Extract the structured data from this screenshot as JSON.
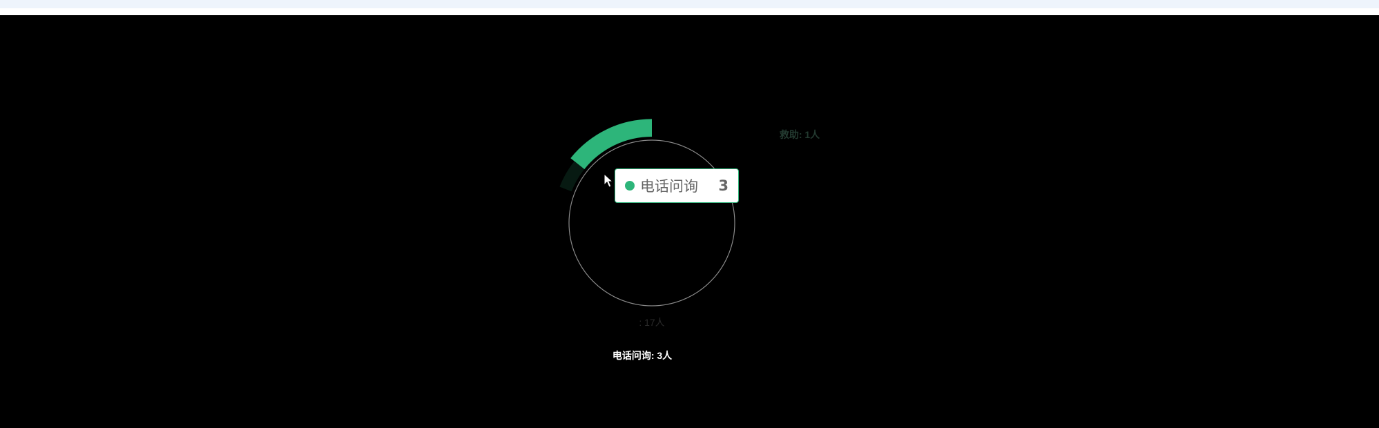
{
  "chart_data": {
    "type": "pie",
    "variant": "rose",
    "unit": "人",
    "slices": [
      {
        "name": "电话问询",
        "value": 3,
        "color": "#2db57a",
        "label": "电话问询: 3人",
        "label_color": "#ffffff"
      },
      {
        "name": "救助",
        "value": 1,
        "color": "#071a12",
        "label": "救助: 1人",
        "label_color": "#233a30"
      },
      {
        "name": "",
        "value": 17,
        "color": "#000000",
        "label": ": 17人",
        "label_color": "#2a2a2a"
      }
    ],
    "center_ring_color": "#8a8a8a"
  },
  "tooltip": {
    "name": "电话问询",
    "value": "3",
    "color": "#2db57a"
  }
}
